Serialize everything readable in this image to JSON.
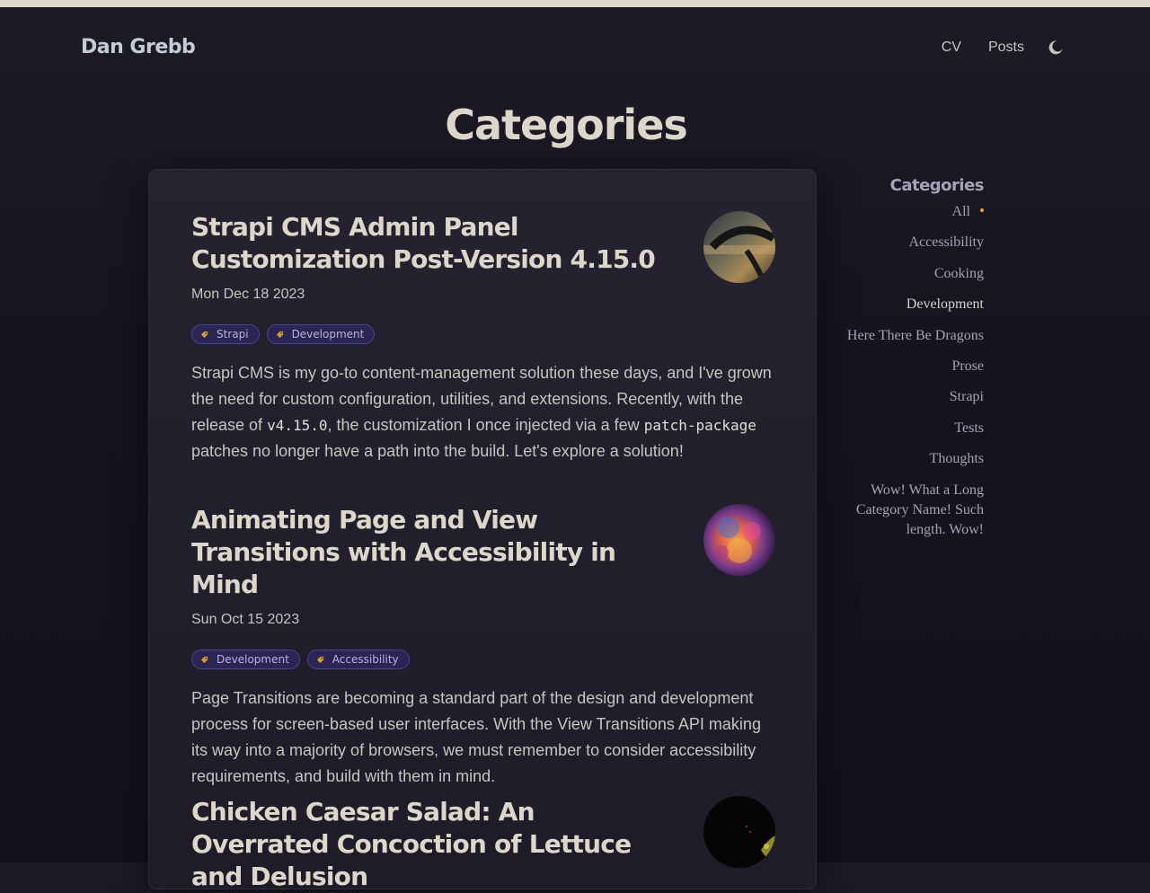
{
  "header": {
    "site_title": "Dan Grebb",
    "nav": [
      {
        "label": "CV"
      },
      {
        "label": "Posts"
      }
    ],
    "theme_toggle_icon": "moon-icon"
  },
  "page": {
    "title": "Categories"
  },
  "posts": [
    {
      "title": "Strapi CMS Admin Panel Customization Post-Version 4.15.0",
      "date": "Mon Dec 18 2023",
      "tags": [
        "Strapi",
        "Development"
      ],
      "excerpt": {
        "part1": "Strapi CMS is my go-to content-management solution these days, and I've grown the need for custom configuration, utilities, and extensions. Recently, with the release of ",
        "code1": "v4.15.0",
        "part2": ", the customization I once injected via a few ",
        "code2": "patch-package",
        "part3": " patches no longer have a path into the build. Let's explore a solution!"
      },
      "thumbnail_icon": "steering-wheel-photo"
    },
    {
      "title": "Animating Page and View Transitions with Accessibility in Mind",
      "date": "Sun Oct 15 2023",
      "tags": [
        "Development",
        "Accessibility"
      ],
      "excerpt": {
        "text": "Page Transitions are becoming a standard part of the design and development process for screen-based user interfaces. With the View Transitions API making its way into a majority of browsers, we must remember to consider accessibility requirements, and build with them in mind."
      },
      "thumbnail_icon": "colorful-smoke-photo"
    },
    {
      "title": "Chicken Caesar Salad: An Overrated Concoction of Lettuce and Delusion",
      "thumbnail_icon": "dark-salad-photo"
    }
  ],
  "sidebar": {
    "heading": "Categories",
    "items": [
      {
        "label": "All",
        "current": true
      },
      {
        "label": "Accessibility"
      },
      {
        "label": "Cooking"
      },
      {
        "label": "Development",
        "highlighted": true
      },
      {
        "label": "Here There Be Dragons"
      },
      {
        "label": "Prose"
      },
      {
        "label": "Strapi"
      },
      {
        "label": "Tests"
      },
      {
        "label": "Thoughts"
      },
      {
        "label": "Wow! What a Long Category Name! Such length. Wow!"
      }
    ]
  },
  "colors": {
    "background": "#15141f",
    "card": "#24232f",
    "accent_dot": "#e0a43c",
    "tag_background": "#2b2553",
    "tag_border": "#4a4590"
  }
}
